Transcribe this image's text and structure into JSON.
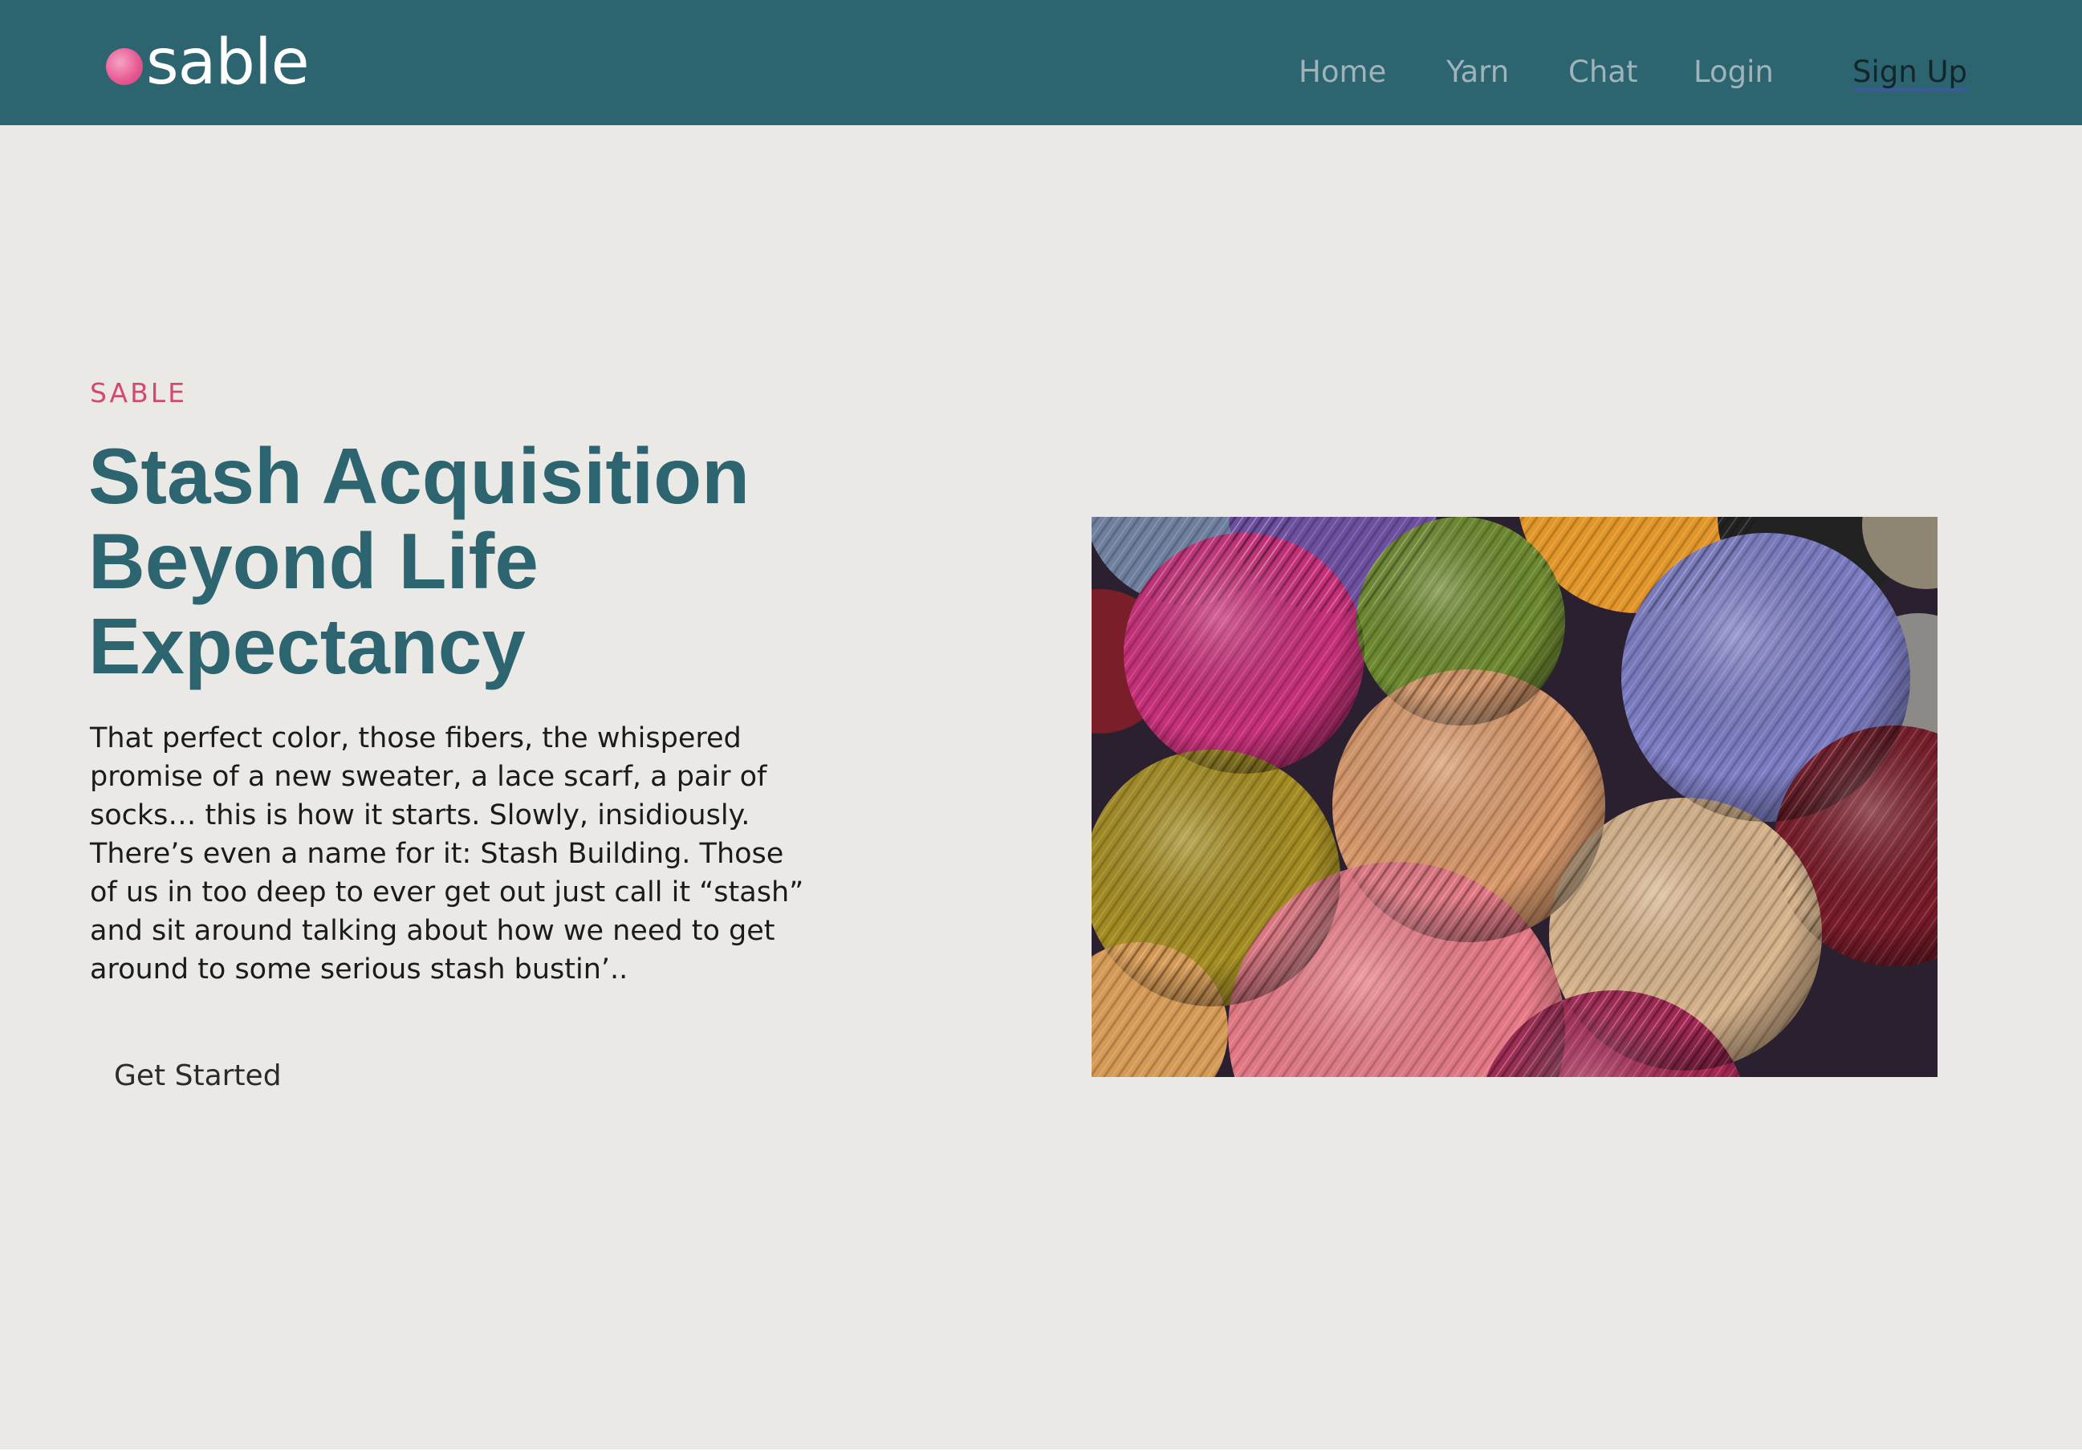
{
  "header": {
    "logo_text": "sable",
    "brand_color": "#2c6470",
    "nav": [
      {
        "label": "Home"
      },
      {
        "label": "Yarn"
      },
      {
        "label": "Chat"
      },
      {
        "label": "Login"
      },
      {
        "label": "Sign Up"
      }
    ]
  },
  "hero": {
    "eyebrow": "SABLE",
    "headline": "Stash Acquisition Beyond Life Expectancy",
    "body": "That perfect color, those fibers, the whispered promise of a new sweater, a lace scarf, a pair of socks… this is how it starts. Slowly, insidiously. There’s even a name for it: Stash Building. Those of us in too deep to ever get out just call it “stash” and sit around talking about how we need to get around to some serious stash bustin’..",
    "cta_label": "Get Started",
    "image_icon": "yarn-balls-photo",
    "accent_color": "#d24b6f"
  }
}
